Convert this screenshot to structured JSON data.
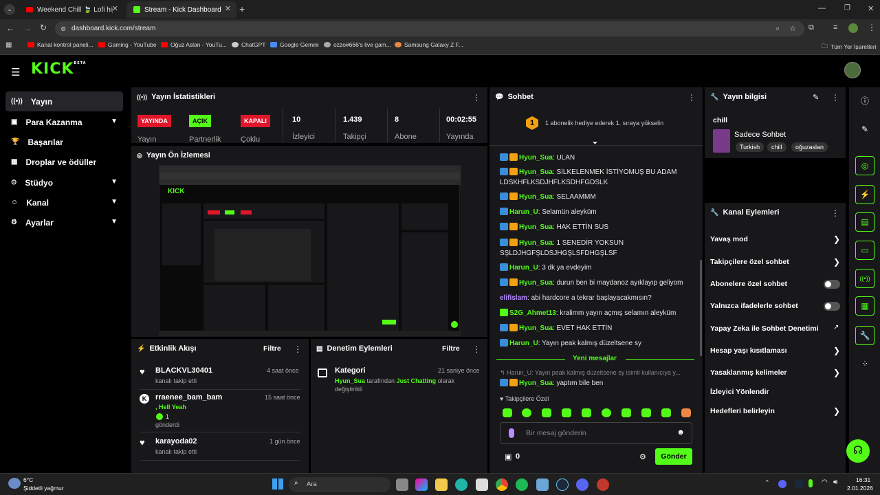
{
  "browser": {
    "tabs": [
      {
        "label": "Weekend Chill 🍃 Lofi hip h",
        "active": false
      },
      {
        "label": "Stream - Kick Dashboard",
        "active": true
      }
    ],
    "new_tab": "+",
    "url": "dashboard.kick.com/stream",
    "bookmarks": [
      "Kanal kontrol paneli...",
      "Gaming - YouTube",
      "Oğuz Aslan - YouTu...",
      "ChatGPT",
      "Google Gemini",
      "ozzo#666's live gam...",
      "Samsung Galaxy Z F..."
    ],
    "all_bookmarks": "Tüm Yer İşaretleri"
  },
  "header": {
    "logo": "KICK",
    "logo_badge": "BETA"
  },
  "sidebar": {
    "items": [
      {
        "label": "Yayın",
        "icon": "broadcast-icon",
        "active": true
      },
      {
        "label": "Para Kazanma",
        "icon": "money-icon",
        "expand": true
      },
      {
        "label": "Başarılar",
        "icon": "trophy-icon"
      },
      {
        "label": "Droplar ve ödüller",
        "icon": "gift-icon"
      },
      {
        "label": "Stüdyo",
        "icon": "studio-icon",
        "expand": true
      },
      {
        "label": "Kanal",
        "icon": "channel-icon",
        "expand": true
      },
      {
        "label": "Ayarlar",
        "icon": "gear-icon",
        "expand": true
      }
    ]
  },
  "stats": {
    "title": "Yayın İstatistikleri",
    "live_badge": "YAYINDA",
    "live_label": "Yayın",
    "partner_badge": "AÇIK",
    "partner_label": "Partnerlik",
    "multi_badge": "KAPALI",
    "multi_label": "Çoklu",
    "viewers": "10",
    "viewers_label": "İzleyici",
    "followers": "1.439",
    "followers_label": "Takipçi",
    "subs": "8",
    "subs_label": "Abone",
    "uptime": "00:02:55",
    "uptime_label": "Yayında"
  },
  "preview": {
    "title": "Yayın Ön İzlemesi"
  },
  "activity": {
    "title": "Etkinlik Akışı",
    "filter": "Filtre",
    "items": [
      {
        "user": "BLACKVL30401",
        "desc": "kanalı takip etti",
        "time": "4 saat önce",
        "icon": "heart-icon"
      },
      {
        "user": "rraenee_bam_bam",
        "extra": ", Hell Yeah",
        "count": "1",
        "desc": "gönderdi",
        "time": "15 saat önce",
        "icon": "kick-icon"
      },
      {
        "user": "karayoda02",
        "desc": "kanalı takip etti",
        "time": "1 gün önce",
        "icon": "heart-icon"
      }
    ]
  },
  "moderation": {
    "title": "Denetim Eylemleri",
    "filter": "Filtre",
    "item": {
      "title": "Kategori",
      "time": "21 saniye önce",
      "user": "Hyun_Sua",
      "mid": " tarafından ",
      "category": "Just Chatting",
      "end": " olarak",
      "line2": "değiştirildi"
    }
  },
  "chat": {
    "title": "Sohbet",
    "pin_rank": "1",
    "pin_text": "1 abonelik hediye ederek 1. sıraya yükselin",
    "messages": [
      {
        "user": "Hyun_Sua",
        "text": ": ULAN"
      },
      {
        "user": "Hyun_Sua",
        "text": ": SİLKELENMEK İSTİYOMUŞ BU ADAM LDSKHFLKSDJHFLKSDHFGDSLK"
      },
      {
        "user": "Hyun_Sua",
        "text": ": SELAAMMM"
      },
      {
        "user": "Harun_U",
        "text": ": Selamün aleyküm"
      },
      {
        "user": "Hyun_Sua",
        "text": ": HAK ETTİN SUS"
      },
      {
        "user": "Hyun_Sua",
        "text": ": 1 SENEDİR YOKSUN SŞLDJHGFŞLDSJHGŞLSFDHGŞLSF"
      },
      {
        "user": "Harun_U",
        "text": ": 3 dk ya evdeyim"
      },
      {
        "user": "Hyun_Sua",
        "text": ": durun ben bi maydanoz ayıklayıp geliyom"
      },
      {
        "user": "elifislam",
        "text": ": abi hardcore a tekrar başlayacakmısın?"
      },
      {
        "user": "S2G_Ahmet13",
        "text": ": kralimm yayın açmış selamın aleyküm"
      },
      {
        "user": "Hyun_Sua",
        "text": ": EVET HAK ETTİN"
      },
      {
        "user": "Harun_U",
        "text": ": Yayın peak kalmış düzeltsene sy"
      }
    ],
    "new_messages": "Yeni mesajlar",
    "reply_preview": "Harun_U: Yayın peak kalmış düzeltsene sy isimli kullanıcıya y...",
    "reply_user": "Hyun_Sua",
    "reply_text": ": yaptım bile ben",
    "followers_only": "Takipçilere Özel",
    "input_placeholder": "Bir mesaj gönderin",
    "points": "0",
    "send": "Gönder"
  },
  "info": {
    "title": "Yayın bilgisi",
    "stream_title": "chill",
    "category": "Sadece Sohbet",
    "tags": [
      "Turkish",
      "chill",
      "oğuzaslan"
    ]
  },
  "channel_actions": {
    "title": "Kanal Eylemleri",
    "items": [
      {
        "label": "Yavaş mod",
        "type": "chevron"
      },
      {
        "label": "Takipçilere özel sohbet",
        "type": "chevron"
      },
      {
        "label": "Abonelere özel sohbet",
        "type": "toggle"
      },
      {
        "label": "Yalnızca ifadelerle sohbet",
        "type": "toggle"
      },
      {
        "label": "Yapay Zeka ile Sohbet Denetimi",
        "type": "external"
      },
      {
        "label": "Hesap yaşı kısıtlaması",
        "type": "chevron"
      },
      {
        "label": "Yasaklanmış kelimeler",
        "type": "chevron"
      },
      {
        "label": "İzleyici Yönlendir",
        "type": "none"
      },
      {
        "label": "Hedefleri belirleyin",
        "type": "chevron"
      }
    ]
  },
  "taskbar": {
    "weather_temp": "6°C",
    "weather_desc": "Şiddetli yağmur",
    "search": "Ara",
    "time": "16:31",
    "date": "2.01.2026"
  },
  "colors": {
    "accent": "#53fc18",
    "live_red": "#e0162b",
    "panel": "#18181b",
    "mod_blue": "#3a8dd8",
    "crown": "#f0a010"
  }
}
